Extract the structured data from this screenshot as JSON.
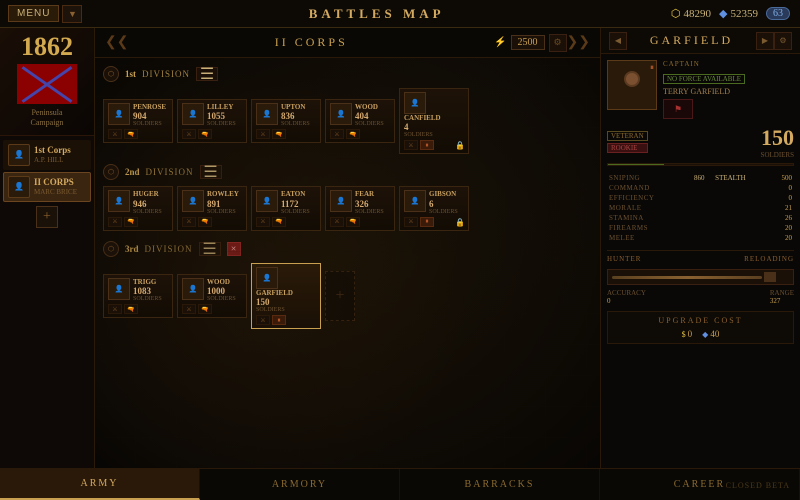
{
  "topBar": {
    "menuLabel": "MENU",
    "title": "BATTLES MAP",
    "resources": {
      "gold": "48290",
      "blue": "52359",
      "badge": "63"
    }
  },
  "sidebar": {
    "year": "1862",
    "campaign": "Peninsula\nCampaign",
    "corps": [
      {
        "name": "1st Corps",
        "commander": "A.P. HILL",
        "active": false
      },
      {
        "name": "II CORPS",
        "commander": "MARC BRICE",
        "active": true
      }
    ],
    "addLabel": "+"
  },
  "corpsHeader": {
    "title": "II CORPS",
    "manpower": "2500",
    "manpowerIcon": "⚡"
  },
  "divisions": [
    {
      "num": "1st",
      "label": "DIVISION",
      "brigades": [
        {
          "name": "PENROSE",
          "soldiers": "904",
          "label": "SOLDIERS",
          "paused": false
        },
        {
          "name": "LILLEY",
          "soldiers": "1055",
          "label": "SOLDIERS",
          "paused": false
        },
        {
          "name": "UPTON",
          "soldiers": "836",
          "label": "SOLDIERS",
          "paused": false
        },
        {
          "name": "WOOD",
          "soldiers": "404",
          "label": "SOLDIERS",
          "paused": false
        },
        {
          "name": "CANFIELD",
          "soldiers": "4",
          "label": "SOLDIERS",
          "paused": true
        }
      ],
      "hasLock": true
    },
    {
      "num": "2nd",
      "label": "DIVISION",
      "brigades": [
        {
          "name": "HUGER",
          "soldiers": "946",
          "label": "SOLDIERS",
          "paused": false
        },
        {
          "name": "ROWLEY",
          "soldiers": "891",
          "label": "SOLDIERS",
          "paused": false
        },
        {
          "name": "EATON",
          "soldiers": "1172",
          "label": "SOLDIERS",
          "paused": false
        },
        {
          "name": "FEAR",
          "soldiers": "326",
          "label": "SOLDIERS",
          "paused": false
        },
        {
          "name": "GIBSON",
          "soldiers": "6",
          "label": "SOLDIERS",
          "paused": true
        }
      ],
      "hasLock": true
    },
    {
      "num": "3rd",
      "label": "DIVISION",
      "brigades": [
        {
          "name": "TRIGG",
          "soldiers": "1083",
          "label": "SOLDIERS",
          "paused": false
        },
        {
          "name": "WOOD",
          "soldiers": "1000",
          "label": "SOLDIERS",
          "paused": false
        },
        {
          "name": "GARFIELD",
          "soldiers": "150",
          "label": "SOLDIERS",
          "paused": true,
          "active": true
        }
      ],
      "hasLock": false,
      "hasExtra": true
    }
  ],
  "rightPanel": {
    "title": "GARFIELD",
    "general": {
      "rank": "CAPTAIN",
      "availability": "NO FORCE AVAILABLE",
      "name": "TERRY GARFIELD",
      "paused": true
    },
    "soldiers": {
      "count": "150",
      "label": "SOLDIERS",
      "veteranLabel": "VETERAN",
      "rookieLabel": "ROOKIE",
      "barPercent": 30
    },
    "stats": [
      {
        "label": "SNIPING",
        "value": "860",
        "label2": "STEALTH",
        "value2": "500"
      },
      {
        "label": "COMMAND",
        "value": "0"
      },
      {
        "label": "EFFICIENCY",
        "value": "0"
      },
      {
        "label": "MORALE",
        "value": "21"
      },
      {
        "label": "STAMINA",
        "value": "26"
      },
      {
        "label": "FIREARMS",
        "value": "20"
      },
      {
        "label": "MELEE",
        "value": "20"
      }
    ],
    "equipment": {
      "type": "HUNTER",
      "reloadingLabel": "RELOADING",
      "stats": [
        {
          "label": "ACCURACY",
          "value": "0"
        },
        {
          "label": "RANGE",
          "value": "327"
        }
      ]
    },
    "upgrade": {
      "title": "UPGRADE COST",
      "goldCost": "0",
      "blueCost": "40"
    }
  },
  "bottomTabs": [
    {
      "label": "ARMY",
      "active": true
    },
    {
      "label": "ARMORY",
      "active": false
    },
    {
      "label": "BARRACKS",
      "active": false
    },
    {
      "label": "CAREER",
      "active": false
    }
  ],
  "closedBeta": "CLOSED BETA"
}
